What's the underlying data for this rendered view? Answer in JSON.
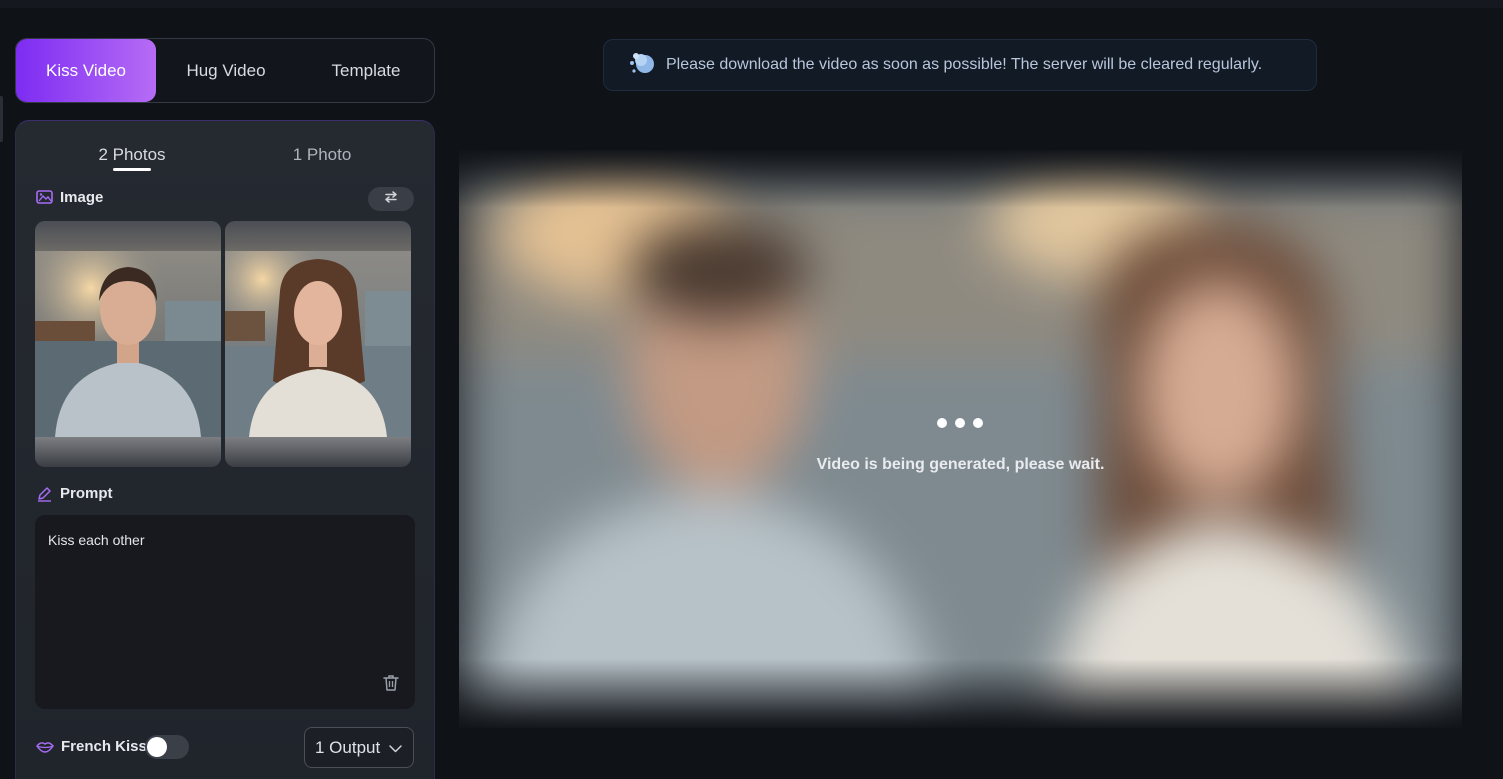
{
  "mode_tabs": [
    {
      "label": "Kiss Video",
      "active": true
    },
    {
      "label": "Hug Video",
      "active": false
    },
    {
      "label": "Template",
      "active": false
    }
  ],
  "sub_tabs": [
    {
      "label": "2 Photos",
      "active": true
    },
    {
      "label": "1 Photo",
      "active": false
    }
  ],
  "image_section": {
    "label": "Image",
    "icon": "image-icon",
    "swap_icon": "swap-arrows-icon"
  },
  "photos": [
    {
      "subject": "man-portrait",
      "sweater_color": "#b9c2c8",
      "bg_color": "#7a7e82"
    },
    {
      "subject": "woman-portrait",
      "sweater_color": "#e4dfd6",
      "bg_color": "#86898c"
    }
  ],
  "prompt_section": {
    "label": "Prompt",
    "icon": "pen-icon",
    "value": "Kiss each other",
    "clear_icon": "trash-icon"
  },
  "french_kiss": {
    "label": "French Kiss",
    "icon": "lips-icon",
    "enabled": false
  },
  "output_select": {
    "value": "1 Output",
    "icon": "chevron-down-icon"
  },
  "notice": {
    "icon": "bubble-icon",
    "text": "Please download the video as soon as possible! The server will be cleared regularly."
  },
  "video": {
    "status_text": "Video is being generated, please wait.",
    "loading_icon": "loading-dots-icon"
  },
  "colors": {
    "accent_start": "#7d2cf2",
    "accent_end": "#b66cf5",
    "background": "#0f1217",
    "panel": "#23272e"
  }
}
